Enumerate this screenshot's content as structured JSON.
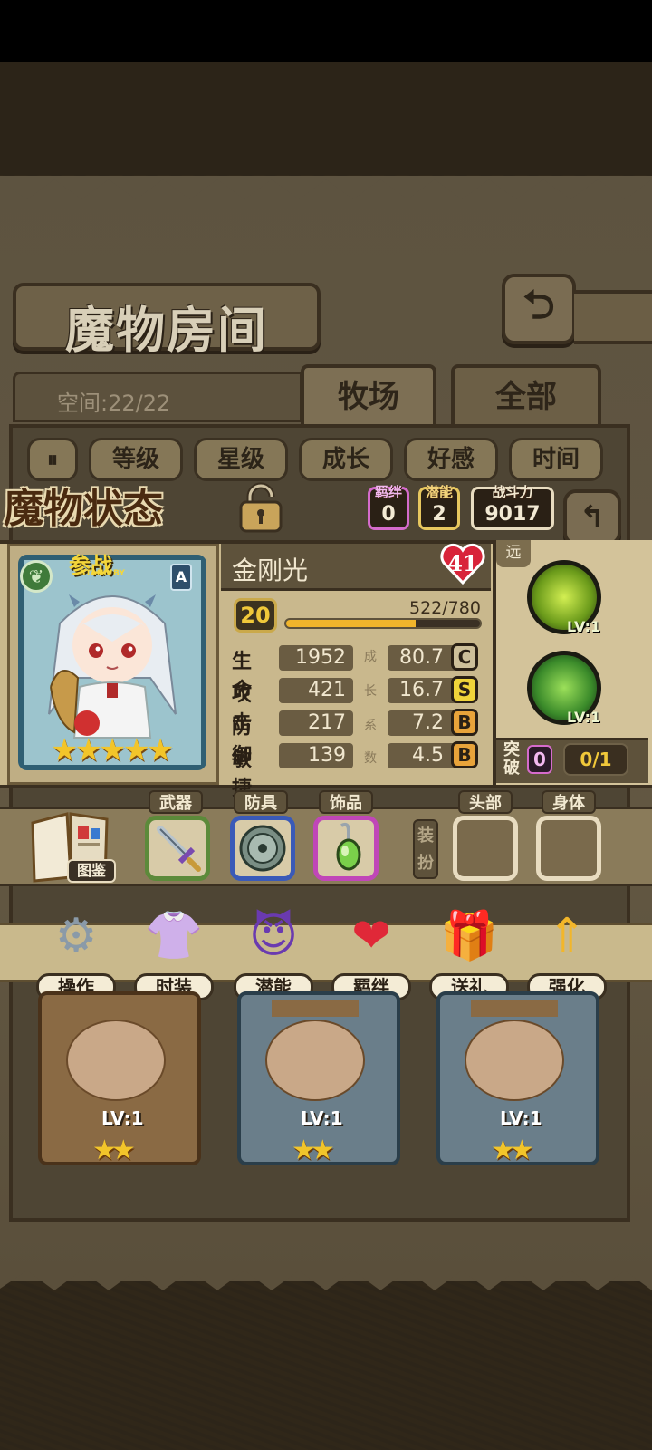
{
  "room": {
    "title": "魔物房间",
    "space_label": "空间:22/22",
    "tabs": [
      "牧场",
      "全部"
    ],
    "sort_buttons": [
      "等级",
      "星级",
      "成长",
      "好感",
      "时间"
    ],
    "back_icon": "back-arrow-icon"
  },
  "status": {
    "title": "魔物状态",
    "bond": {
      "label": "羁绊",
      "value": "0"
    },
    "potential": {
      "label": "潜能",
      "value": "2"
    },
    "power": {
      "label": "战斗力",
      "value": "9017"
    }
  },
  "monster": {
    "name": "金刚光",
    "affection": "41",
    "standby_label": "参战",
    "standby_sub": "STAND BY",
    "grade_letter": "A",
    "star_count": 5,
    "level": "20",
    "xp_text": "522/780",
    "xp_fraction": 0.669,
    "attributes": [
      {
        "name": "生命",
        "value": "1952",
        "growth": "80.7",
        "grade": "C"
      },
      {
        "name": "攻击",
        "value": "421",
        "growth": "16.7",
        "grade": "S"
      },
      {
        "name": "防御",
        "value": "217",
        "growth": "7.2",
        "grade": "B"
      },
      {
        "name": "敏捷",
        "value": "139",
        "growth": "4.5",
        "grade": "B"
      }
    ],
    "growth_label": [
      "成",
      "长",
      "系",
      "数"
    ],
    "range": "远",
    "skills": [
      {
        "level": "LV:1",
        "icon": "lyre-skill-icon"
      },
      {
        "level": "LV:1",
        "icon": "arrow-skill-icon"
      }
    ],
    "breakthrough": {
      "label": "突破",
      "count": "0",
      "progress": "0/1"
    }
  },
  "equipment": {
    "book_label": "图鉴",
    "slots": [
      {
        "label": "武器",
        "icon": "sword-icon"
      },
      {
        "label": "防具",
        "icon": "shield-icon"
      },
      {
        "label": "饰品",
        "icon": "pendant-icon"
      }
    ],
    "dress_label": "装扮",
    "dress_slots": [
      {
        "label": "头部"
      },
      {
        "label": "身体"
      }
    ]
  },
  "actions": [
    {
      "label": "操作",
      "icon": "gear-icon"
    },
    {
      "label": "时装",
      "icon": "costume-icon"
    },
    {
      "label": "潜能",
      "icon": "demon-icon"
    },
    {
      "label": "羁绊",
      "icon": "hearts-icon"
    },
    {
      "label": "送礼",
      "icon": "gift-icon"
    },
    {
      "label": "强化",
      "icon": "upgrade-arrows-icon"
    }
  ],
  "monster_list": [
    {
      "level": "LV:1",
      "stars": 2
    },
    {
      "level": "LV:1",
      "stars": 2
    },
    {
      "level": "LV:1",
      "stars": 2
    }
  ],
  "colors": {
    "gold": "#f2c52a",
    "bond_border": "#d56bcc",
    "potential_border": "#e7c75f"
  }
}
